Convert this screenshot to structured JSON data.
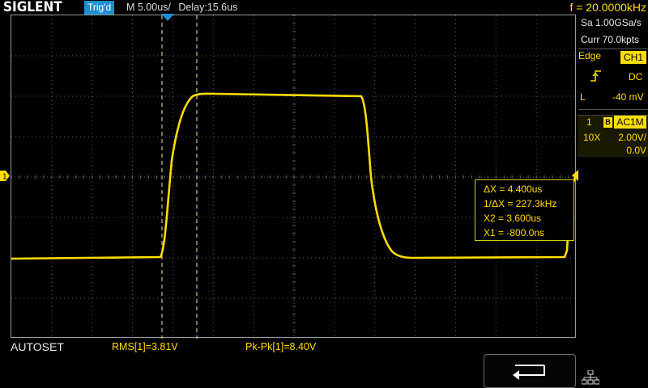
{
  "header": {
    "brand": "SIGLENT",
    "trigger_status": "Trig'd",
    "timebase": "M 5.00us/",
    "delay": "Delay:15.6us",
    "frequency": "f = 20.0000kHz"
  },
  "acquisition": {
    "sample_rate": "Sa 1.00GSa/s",
    "memory": "Curr 70.0kpts"
  },
  "trigger": {
    "type": "Edge",
    "source": "CH1",
    "slope_icon": "rising-edge-icon",
    "coupling": "DC",
    "level_label": "L",
    "level": "-40 mV"
  },
  "channel1": {
    "number": "1",
    "bw_limit": "B",
    "coupling": "AC1M",
    "probe": "10X",
    "volts_per_div": "2.00V/",
    "offset": "0.0V",
    "marker_label": "1"
  },
  "cursors": {
    "delta_x": "ΔX = 4.400us",
    "inv_delta_x": "1/ΔX = 227.3kHz",
    "x2": "X2 = 3.600us",
    "x1": "X1 = -800.0ns"
  },
  "bottom": {
    "mode": "AUTOSET",
    "rms": "RMS[1]=3.81V",
    "pkpk": "Pk-Pk[1]=8.40V"
  },
  "icons": {
    "back": "return-arrow-icon",
    "network": "network-icon"
  },
  "colors": {
    "trace": "#ffdd00",
    "trigger_badge": "#1b8fd4",
    "grid": "#5a5a5a"
  }
}
